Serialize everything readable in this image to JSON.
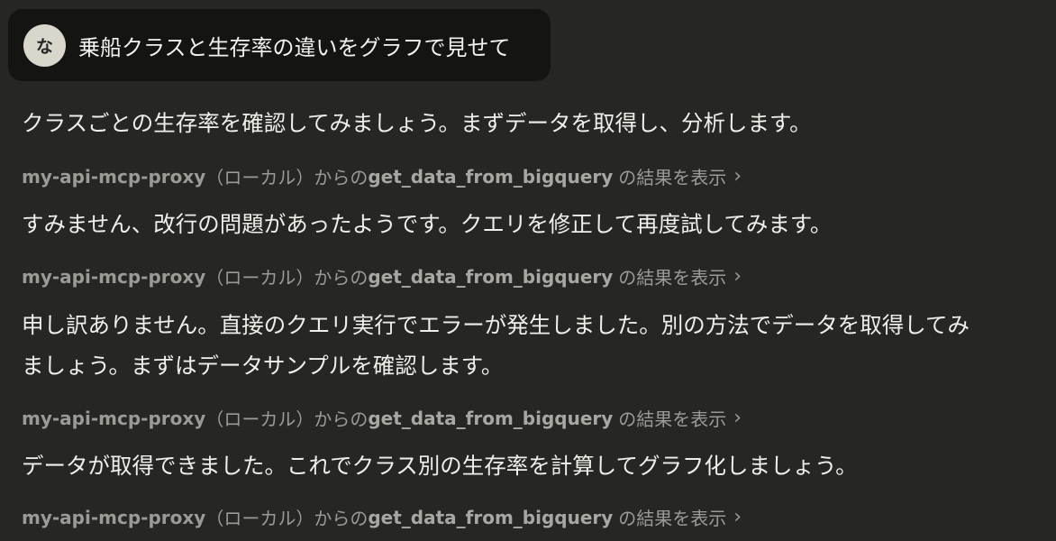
{
  "user_message": {
    "avatar_initial": "な",
    "text": "乗船クラスと生存率の違いをグラフで見せて"
  },
  "assistant": {
    "msg1": "クラスごとの生存率を確認してみましょう。まずデータを取得し、分析します。",
    "msg2": "すみません、改行の問題があったようです。クエリを修正して再度試してみます。",
    "msg3_line1": "申し訳ありません。直接のクエリ実行でエラーが発生しました。別の方法でデータを取得してみ",
    "msg3_line2": "ましょう。まずはデータサンプルを確認します。",
    "msg4": "データが取得できました。これでクラス別の生存率を計算してグラフ化しましょう。"
  },
  "tool_call": {
    "server": "my-api-mcp-proxy",
    "local_suffix": "（ローカル）からの",
    "tool": "get_data_from_bigquery",
    "result_label": "の結果を表示",
    "chevron": "›"
  }
}
